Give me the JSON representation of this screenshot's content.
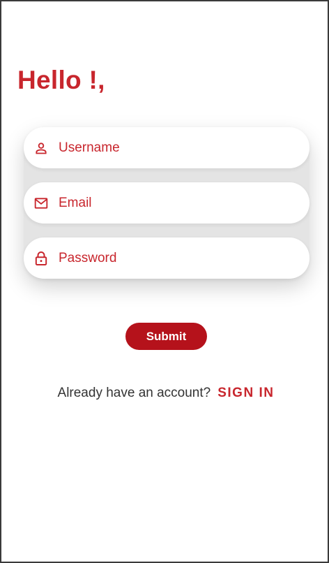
{
  "greeting": "Hello !,",
  "form": {
    "username": {
      "placeholder": "Username",
      "icon": "person-icon"
    },
    "email": {
      "placeholder": "Email",
      "icon": "mail-icon"
    },
    "password": {
      "placeholder": "Password",
      "icon": "lock-icon"
    }
  },
  "submit_label": "Submit",
  "footer": {
    "question": "Already have an account?",
    "link": "SIGN IN"
  },
  "colors": {
    "accent": "#c8262d",
    "button": "#b5121b",
    "text": "#333333"
  }
}
